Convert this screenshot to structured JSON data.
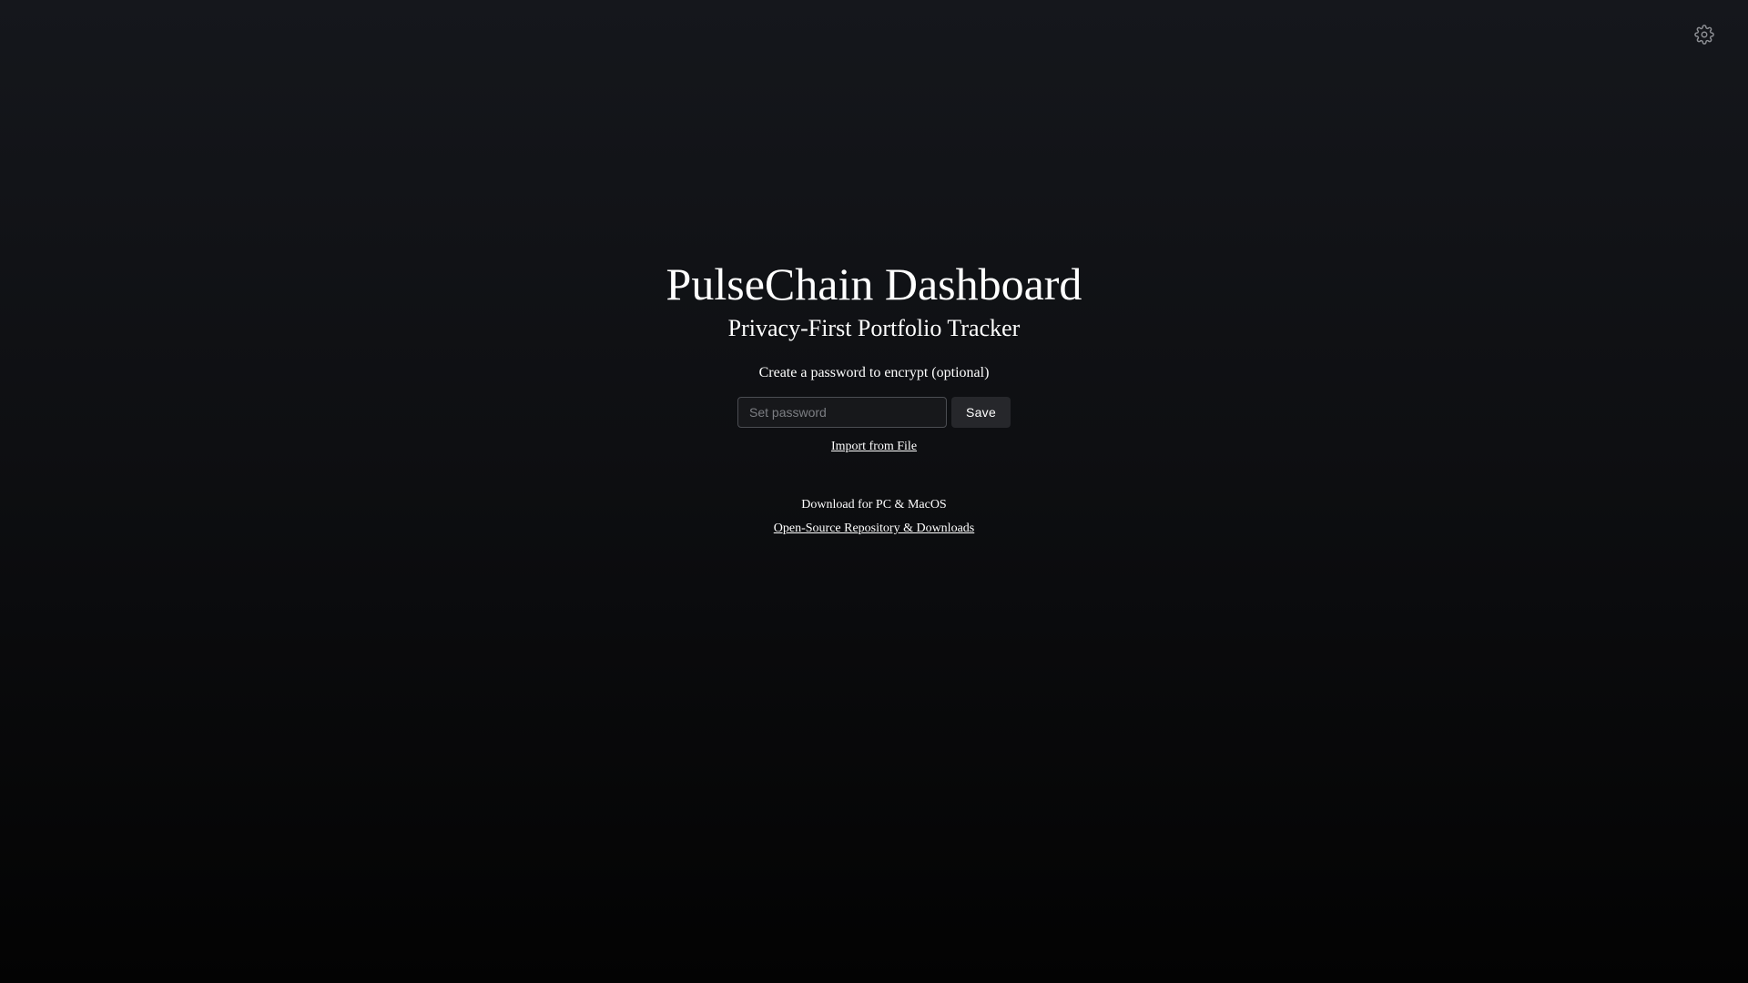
{
  "header": {
    "settings_icon": "gear-icon"
  },
  "main": {
    "title": "PulseChain Dashboard",
    "subtitle": "Privacy-First Portfolio Tracker",
    "password_prompt": "Create a password to encrypt (optional)",
    "password_placeholder": "Set password",
    "password_value": "",
    "save_label": "Save",
    "import_label": "Import from File",
    "download_label": "Download for PC & MacOS",
    "repo_link_label": "Open-Source Repository & Downloads"
  },
  "colors": {
    "background_top": "#15171c",
    "background_bottom": "#030303",
    "text": "#ffffff",
    "input_border": "#4b4d52",
    "button_bg": "#26272b"
  }
}
